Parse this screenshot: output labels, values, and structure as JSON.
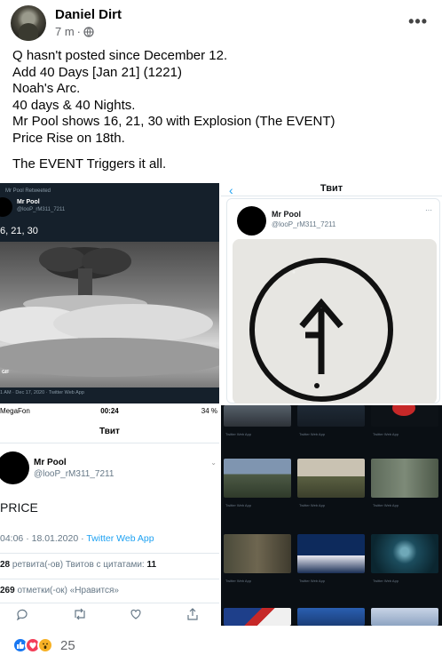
{
  "post": {
    "author": "Daniel Dirt",
    "time": "7 m",
    "time_separator": "·",
    "privacy_icon": "globe-icon",
    "more_icon": "more-horizontal-icon",
    "more_label": "•••",
    "text_lines": [
      "Q hasn't posted since December 12.",
      "Add 40 Days [Jan 21] (1221)",
      "Noah's Arc.",
      "40 days & 40 Nights.",
      "Mr Pool shows 16, 21, 30 with Explosion (The EVENT)",
      "Price Rise on 18th."
    ],
    "closing_line": "The EVENT Triggers it all.",
    "reaction_count": "25",
    "reactions": [
      "like-icon",
      "love-icon",
      "wow-icon"
    ]
  },
  "tile1": {
    "retweeted": "Mr Pool Retweeted",
    "name": "Mr Pool",
    "handle": "@looP_rM311_7211",
    "text": "6, 21, 30",
    "badge": "GIF",
    "footer": "1 AM · Dec 17, 2020 · Twitter Web App"
  },
  "tile2": {
    "back_icon": "‹",
    "title": "Твит",
    "name": "Mr Pool",
    "handle": "@looP_rM311_7211",
    "more": "···"
  },
  "tile3": {
    "carrier": "MegaFon",
    "time": "00:24",
    "battery": "34 %",
    "title": "Твит",
    "name": "Mr Pool",
    "handle": "@looP_rM311_7211",
    "chevron": "⌄",
    "text": "PRICE",
    "timestamp": "04:06 · 18.01.2020 · ",
    "source": "Twitter Web App",
    "retweets_count": "28",
    "retweets_label": " ретвита(-ов)   Твитов с цитатами: ",
    "quotes_count": "11",
    "likes_count": "269",
    "likes_label": " отметки(-ок) «Нравится»",
    "actions": [
      "reply-icon",
      "retweet-icon",
      "like-icon",
      "share-icon"
    ]
  },
  "tile4": {
    "caption": "Twitter Web App"
  }
}
